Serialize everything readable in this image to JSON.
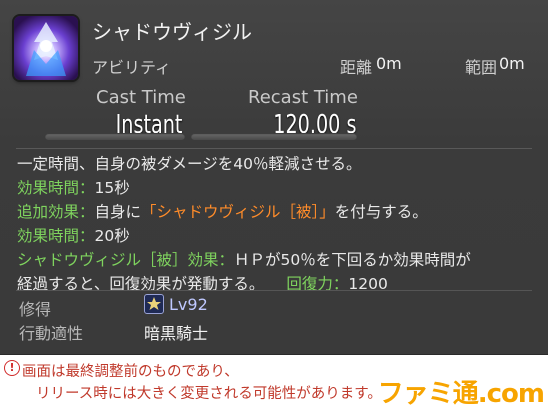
{
  "ability": {
    "name": "シャドウヴィジル",
    "type": "アビリティ",
    "range_label": "距離",
    "range_value": "0m",
    "radius_label": "範囲",
    "radius_value": "0m",
    "icon": "shadowed-vigil-icon"
  },
  "timing": {
    "cast_label": "Cast Time",
    "cast_value": "Instant",
    "recast_label": "Recast Time",
    "recast_value": "120.00 s"
  },
  "description": {
    "line1": "一定時間、自身の被ダメージを40％軽減させる。",
    "effect_time_label_1": "効果時間：",
    "effect_time_value_1": "15秒",
    "extra_effect_label": "追加効果：",
    "extra_effect_pre": "自身に",
    "extra_effect_status": "「シャドウヴィジル［被］」",
    "extra_effect_post": "を付与する。",
    "effect_time_label_2": "効果時間：",
    "effect_time_value_2": "20秒",
    "status_effect_label": "シャドウヴィジル［被］効果：",
    "status_effect_text_1": "ＨＰが50％を下回るか効果時間が",
    "status_effect_text_2": "経過すると、回復効果が発動する。",
    "cure_label": "回復力：",
    "cure_value": "1200"
  },
  "acquire": {
    "label": "修得",
    "level": "Lv92",
    "job_icon": "dark-knight-job-icon"
  },
  "class": {
    "label": "行動適性",
    "value": "暗黒騎士"
  },
  "notice": {
    "line1": "画面は最終調整前のものであり、",
    "line2": "リリース時には大きく変更される可能性があります。"
  },
  "watermark": "ファミ通.com",
  "colors": {
    "green": "#7fd45e",
    "orange": "#ff8c2a",
    "notice_red": "#c0392b",
    "logo_orange": "#f7a400"
  }
}
